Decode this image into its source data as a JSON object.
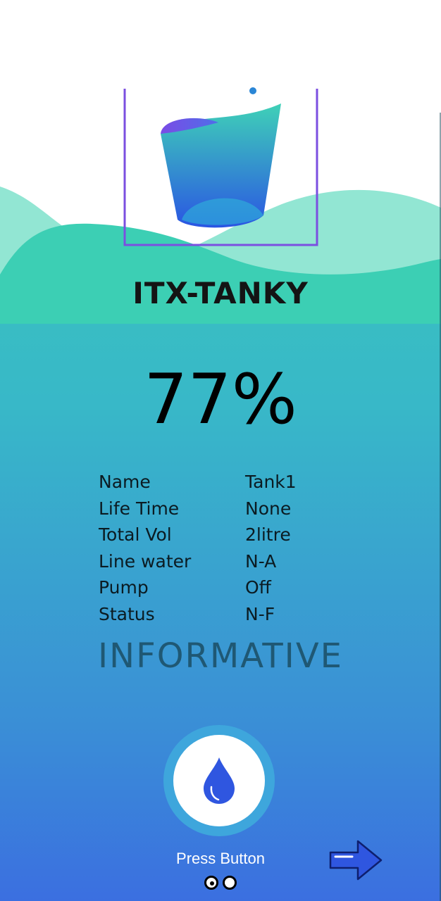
{
  "app": {
    "title": "ITX-TANKY"
  },
  "tank": {
    "level": "77%",
    "info": [
      {
        "key": "Name",
        "value": "Tank1"
      },
      {
        "key": "Life Time",
        "value": "None"
      },
      {
        "key": "Total Vol",
        "value": "2litre"
      },
      {
        "key": "Line water",
        "value": "N-A"
      },
      {
        "key": "Pump",
        "value": "Off"
      },
      {
        "key": "Status",
        "value": "N-F"
      }
    ],
    "mode_label": "INFORMATIVE"
  },
  "action": {
    "caption": "Press Button",
    "button_icon": "water-drop-icon",
    "next_icon": "arrow-right-icon"
  },
  "pager": {
    "total": 2,
    "active": 1
  },
  "colors": {
    "accent_blue": "#2f56e0",
    "button_ring": "#3ea6dc",
    "mint": "#8fe6d2",
    "teal": "#3ccfb4"
  }
}
